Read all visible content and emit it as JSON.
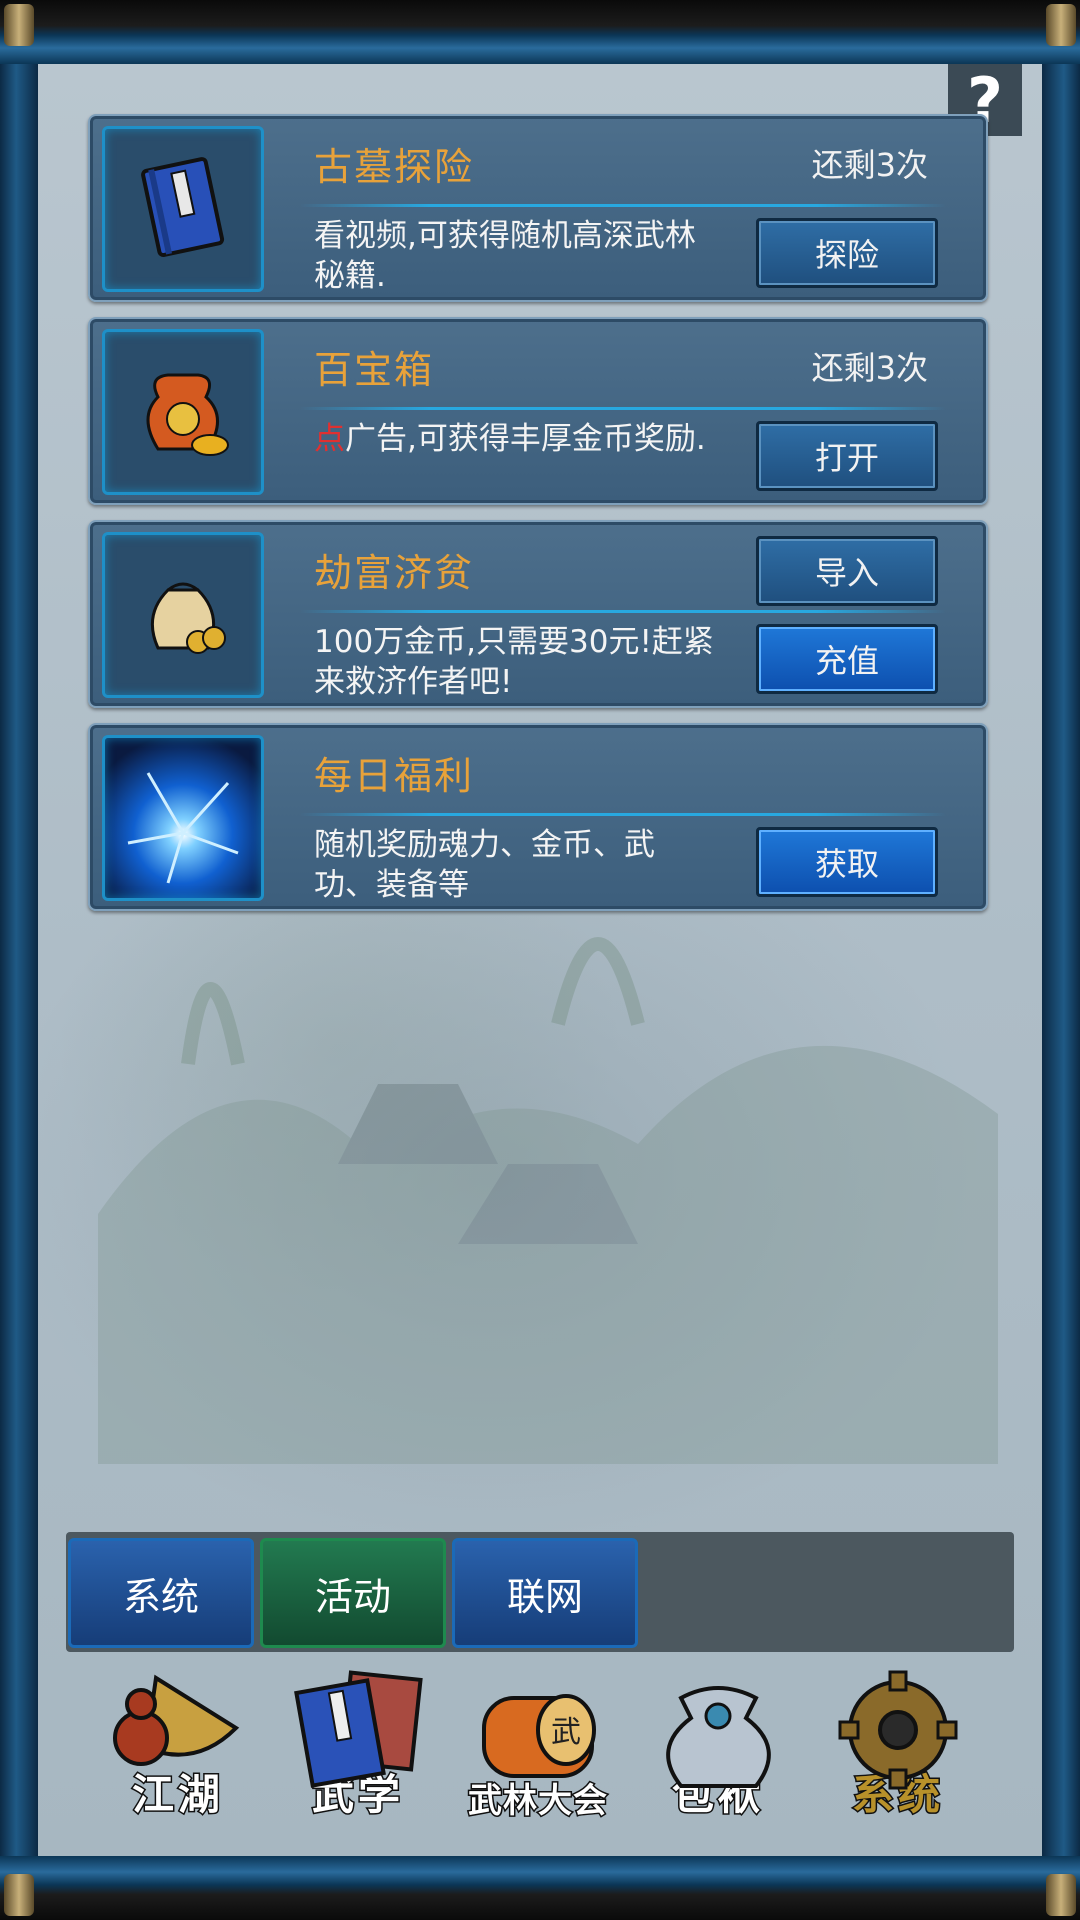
{
  "help_icon": "question-mark",
  "cards": [
    {
      "title": "古墓探险",
      "remaining": "还剩3次",
      "desc_prefix": "",
      "desc": "看视频,可获得随机高深武林秘籍.",
      "buttons": [
        "探险"
      ],
      "icon": "blue-book-icon"
    },
    {
      "title": "百宝箱",
      "remaining": "还剩3次",
      "desc_prefix": "点",
      "desc": "广告,可获得丰厚金币奖励.",
      "buttons": [
        "打开"
      ],
      "icon": "treasure-bag-icon"
    },
    {
      "title": "劫富济贫",
      "remaining": "",
      "desc_prefix": "",
      "desc": "100万金币,只需要30元!赶紧来救济作者吧!",
      "buttons": [
        "导入",
        "充值"
      ],
      "icon": "coin-pouch-icon"
    },
    {
      "title": "每日福利",
      "remaining": "",
      "desc_prefix": "",
      "desc": "随机奖励魂力、金币、武功、装备等",
      "buttons": [
        "获取"
      ],
      "icon": "lightning-orb-icon"
    }
  ],
  "tabs": [
    {
      "label": "系统",
      "active": false
    },
    {
      "label": "活动",
      "active": true
    },
    {
      "label": "联网",
      "active": false
    }
  ],
  "nav": [
    {
      "label": "江湖",
      "icon": "gourd-hat-icon"
    },
    {
      "label": "武学",
      "icon": "books-icon"
    },
    {
      "label": "武林大会",
      "icon": "drum-icon"
    },
    {
      "label": "包袱",
      "icon": "bundle-icon"
    },
    {
      "label": "系统",
      "icon": "gear-icon"
    }
  ],
  "colors": {
    "title": "#e8a23a",
    "accent_red": "#e03030",
    "tab_active": "#1e8a4e",
    "tab_normal": "#1b6ab8"
  }
}
